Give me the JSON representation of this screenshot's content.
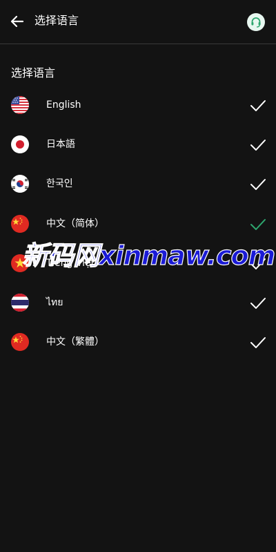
{
  "header": {
    "title": "选择语言",
    "back_icon": "arrow-left-icon",
    "support_icon": "headset-support-icon"
  },
  "section": {
    "title": "选择语言"
  },
  "languages": [
    {
      "label": "English",
      "flag": "us-flag-icon",
      "check_color": "#ffffff"
    },
    {
      "label": "日本語",
      "flag": "japan-flag-icon",
      "check_color": "#ffffff"
    },
    {
      "label": "한국인",
      "flag": "korea-flag-icon",
      "check_color": "#ffffff"
    },
    {
      "label": "中文（简体）",
      "flag": "china-flag-icon",
      "check_color": "#2ea66e",
      "selected": true
    },
    {
      "label": "Tiếng Việt",
      "flag": "vietnam-flag-icon",
      "check_color": "#ffffff"
    },
    {
      "label": "ไทย",
      "flag": "thailand-flag-icon",
      "check_color": "#ffffff"
    },
    {
      "label": "中文（繁體）",
      "flag": "china-flag-icon",
      "check_color": "#ffffff"
    }
  ],
  "watermark": {
    "text": "新码网xinmaw.com"
  },
  "colors": {
    "background": "#131313",
    "accent": "#2ea66e",
    "support_bg": "#e8f7f0",
    "watermark": "#1a1ad6"
  }
}
